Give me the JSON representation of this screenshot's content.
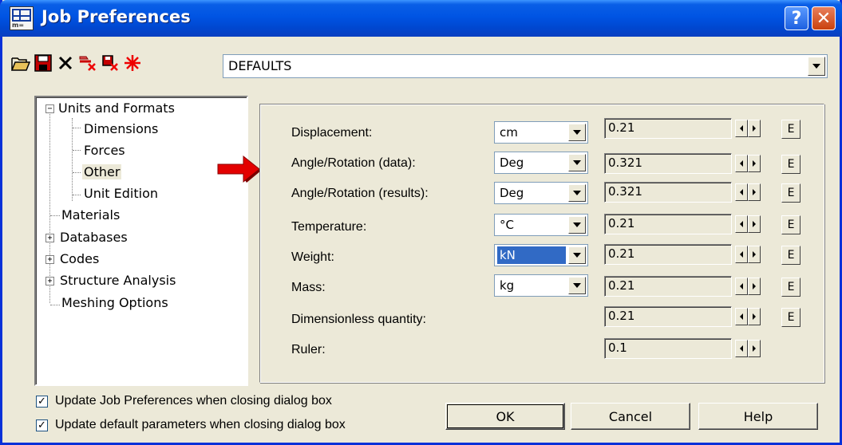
{
  "window": {
    "title": "Job Preferences",
    "icons": {
      "app": "grid-app-icon",
      "help": "question-mark-icon",
      "close": "close-x-icon"
    },
    "help_label": "?",
    "close_label": "✕"
  },
  "toolbar": {
    "icons": [
      "open-folder-icon",
      "save-icon",
      "delete-x-icon",
      "remove-icon-1",
      "remove-icon-2",
      "reset-star-icon"
    ],
    "preset": "DEFAULTS"
  },
  "tree": {
    "items": [
      {
        "label": "Units and Formats",
        "expander": "−"
      },
      {
        "label": "Dimensions"
      },
      {
        "label": "Forces"
      },
      {
        "label": "Other",
        "selected": true
      },
      {
        "label": "Unit Edition"
      },
      {
        "label": "Materials"
      },
      {
        "label": "Databases",
        "expander": "+"
      },
      {
        "label": "Codes",
        "expander": "+"
      },
      {
        "label": "Structure Analysis",
        "expander": "+"
      },
      {
        "label": "Meshing Options"
      }
    ]
  },
  "rows": [
    {
      "label": "Displacement:",
      "unit": "cm",
      "value": "0.21",
      "e": "E"
    },
    {
      "label": "Angle/Rotation (data):",
      "unit": "Deg",
      "value": "0.321",
      "e": "E"
    },
    {
      "label": "Angle/Rotation (results):",
      "unit": "Deg",
      "value": "0.321",
      "e": "E"
    },
    {
      "label": "Temperature:",
      "unit": "°C",
      "value": "0.21",
      "e": "E"
    },
    {
      "label": "Weight:",
      "unit": "kN",
      "value": "0.21",
      "e": "E",
      "highlighted": true
    },
    {
      "label": "Mass:",
      "unit": "kg",
      "value": "0.21",
      "e": "E"
    },
    {
      "label": "Dimensionless quantity:",
      "value": "0.21",
      "e": "E"
    },
    {
      "label": "Ruler:",
      "value": "0.1"
    }
  ],
  "options": {
    "update_job": {
      "label": "Update Job Preferences when closing dialog box",
      "checked": true,
      "mark": "✓"
    },
    "update_default": {
      "label": "Update default parameters when closing dialog box",
      "checked": true,
      "mark": "✓"
    }
  },
  "buttons": {
    "ok": "OK",
    "cancel": "Cancel",
    "help": "Help"
  },
  "colors": {
    "title_bar": "#0054e3",
    "dialog_bg": "#ece9d8",
    "selection": "#316ac5",
    "arrow": "#e30000"
  }
}
